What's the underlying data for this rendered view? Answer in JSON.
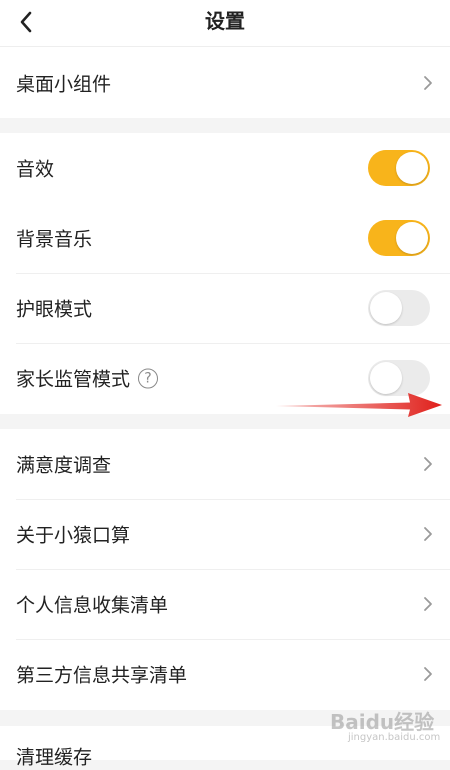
{
  "navbar": {
    "title": "设置",
    "back_icon": "chevron-left-icon"
  },
  "groups": [
    {
      "rows": [
        {
          "label": "桌面小组件",
          "control": "chevron"
        }
      ]
    },
    {
      "rows": [
        {
          "label": "音效",
          "control": "toggle",
          "on": true
        },
        {
          "label": "背景音乐",
          "control": "toggle",
          "on": true
        },
        {
          "label": "护眼模式",
          "control": "toggle",
          "on": false
        },
        {
          "label": "家长监管模式",
          "control": "toggle",
          "on": false,
          "help_icon": "help-circle-icon",
          "help_glyph": "?"
        }
      ]
    },
    {
      "rows": [
        {
          "label": "满意度调查",
          "control": "chevron"
        },
        {
          "label": "关于小猿口算",
          "control": "chevron"
        },
        {
          "label": "个人信息收集清单",
          "control": "chevron"
        },
        {
          "label": "第三方信息共享清单",
          "control": "chevron"
        }
      ]
    },
    {
      "rows": [
        {
          "label": "清理缓存",
          "control": "value-partial"
        }
      ]
    }
  ],
  "annotation": {
    "arrow_color": "#e0201b",
    "icon": "red-arrow-icon"
  },
  "watermark": {
    "brand": "Baidu经验",
    "url": "jingyan.baidu.com"
  },
  "colors": {
    "toggle_on": "#f8b41b",
    "toggle_off": "#ebebeb",
    "background": "#f4f4f4"
  }
}
